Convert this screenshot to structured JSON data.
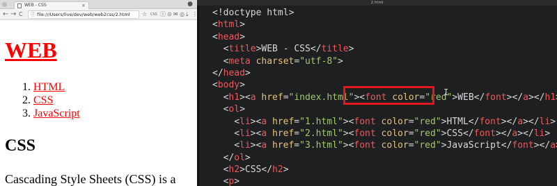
{
  "browser": {
    "tab_title": "WEB - CSS",
    "tab_close": "×",
    "account_icon": "user-circle-icon",
    "nav": {
      "back": "←",
      "forward": "→",
      "reload": "C"
    },
    "address": {
      "info": "ⓘ",
      "url": "file:///Users/live/dev/web/web2css/2.html"
    },
    "toolbar_icons": [
      "☆",
      "CSS",
      "ⓘ",
      "⊙",
      "✉",
      "◎",
      "⤓",
      "⋮"
    ]
  },
  "page": {
    "h1": "WEB",
    "list": [
      {
        "num": "1.",
        "text": "HTML"
      },
      {
        "num": "2.",
        "text": "CSS"
      },
      {
        "num": "3.",
        "text": "JavaScript"
      }
    ],
    "h2": "CSS",
    "paragraph": "Cascading Style Sheets (CSS) is a"
  },
  "editor": {
    "filename": "2.html",
    "cursor_glyph": "I",
    "lines": [
      {
        "indent": 0,
        "tokens": [
          {
            "c": "p",
            "v": "<!doctype html>"
          }
        ]
      },
      {
        "indent": 0,
        "tokens": [
          {
            "c": "p",
            "v": "<"
          },
          {
            "c": "t",
            "v": "html"
          },
          {
            "c": "p",
            "v": ">"
          }
        ]
      },
      {
        "indent": 0,
        "tokens": [
          {
            "c": "p",
            "v": "<"
          },
          {
            "c": "t",
            "v": "head"
          },
          {
            "c": "p",
            "v": ">"
          }
        ]
      },
      {
        "indent": 1,
        "tokens": [
          {
            "c": "p",
            "v": "<"
          },
          {
            "c": "t",
            "v": "title"
          },
          {
            "c": "p",
            "v": ">WEB - CSS</"
          },
          {
            "c": "t",
            "v": "title"
          },
          {
            "c": "p",
            "v": ">"
          }
        ]
      },
      {
        "indent": 1,
        "tokens": [
          {
            "c": "p",
            "v": "<"
          },
          {
            "c": "t",
            "v": "meta"
          },
          {
            "c": "p",
            "v": " "
          },
          {
            "c": "a",
            "v": "charset"
          },
          {
            "c": "p",
            "v": "="
          },
          {
            "c": "s",
            "v": "\"utf-8\""
          },
          {
            "c": "p",
            "v": ">"
          }
        ]
      },
      {
        "indent": 0,
        "tokens": [
          {
            "c": "p",
            "v": "</"
          },
          {
            "c": "t",
            "v": "head"
          },
          {
            "c": "p",
            "v": ">"
          }
        ]
      },
      {
        "indent": 0,
        "tokens": [
          {
            "c": "p",
            "v": "<"
          },
          {
            "c": "t",
            "v": "body"
          },
          {
            "c": "p",
            "v": ">"
          }
        ]
      },
      {
        "indent": 1,
        "tokens": [
          {
            "c": "p",
            "v": "<"
          },
          {
            "c": "t",
            "v": "h1"
          },
          {
            "c": "p",
            "v": "><"
          },
          {
            "c": "t",
            "v": "a"
          },
          {
            "c": "p",
            "v": " "
          },
          {
            "c": "a",
            "v": "href"
          },
          {
            "c": "p",
            "v": "="
          },
          {
            "c": "s",
            "v": "\"index.html\""
          },
          {
            "c": "p",
            "v": "><"
          },
          {
            "c": "t",
            "v": "font"
          },
          {
            "c": "p",
            "v": " "
          },
          {
            "c": "a",
            "v": "color"
          },
          {
            "c": "p",
            "v": "="
          },
          {
            "c": "s",
            "v": "\"red\""
          },
          {
            "c": "p",
            "v": ">WEB</"
          },
          {
            "c": "t",
            "v": "font"
          },
          {
            "c": "p",
            "v": "></"
          },
          {
            "c": "t",
            "v": "a"
          },
          {
            "c": "p",
            "v": "></"
          },
          {
            "c": "t",
            "v": "h1"
          },
          {
            "c": "p",
            "v": ">"
          }
        ]
      },
      {
        "indent": 1,
        "tokens": [
          {
            "c": "p",
            "v": "<"
          },
          {
            "c": "t",
            "v": "ol"
          },
          {
            "c": "p",
            "v": ">"
          }
        ]
      },
      {
        "indent": 2,
        "tokens": [
          {
            "c": "p",
            "v": "<"
          },
          {
            "c": "t",
            "v": "li"
          },
          {
            "c": "p",
            "v": "><"
          },
          {
            "c": "t",
            "v": "a"
          },
          {
            "c": "p",
            "v": " "
          },
          {
            "c": "a",
            "v": "href"
          },
          {
            "c": "p",
            "v": "="
          },
          {
            "c": "s",
            "v": "\"1.html\""
          },
          {
            "c": "p",
            "v": "><"
          },
          {
            "c": "t",
            "v": "font"
          },
          {
            "c": "p",
            "v": " "
          },
          {
            "c": "a",
            "v": "color"
          },
          {
            "c": "p",
            "v": "="
          },
          {
            "c": "s",
            "v": "\"red\""
          },
          {
            "c": "p",
            "v": ">HTML</"
          },
          {
            "c": "t",
            "v": "font"
          },
          {
            "c": "p",
            "v": "></"
          },
          {
            "c": "t",
            "v": "a"
          },
          {
            "c": "p",
            "v": "></"
          },
          {
            "c": "t",
            "v": "li"
          },
          {
            "c": "p",
            "v": ">"
          }
        ]
      },
      {
        "indent": 2,
        "tokens": [
          {
            "c": "p",
            "v": "<"
          },
          {
            "c": "t",
            "v": "li"
          },
          {
            "c": "p",
            "v": "><"
          },
          {
            "c": "t",
            "v": "a"
          },
          {
            "c": "p",
            "v": " "
          },
          {
            "c": "a",
            "v": "href"
          },
          {
            "c": "p",
            "v": "="
          },
          {
            "c": "s",
            "v": "\"2.html\""
          },
          {
            "c": "p",
            "v": "><"
          },
          {
            "c": "t",
            "v": "font"
          },
          {
            "c": "p",
            "v": " "
          },
          {
            "c": "a",
            "v": "color"
          },
          {
            "c": "p",
            "v": "="
          },
          {
            "c": "s",
            "v": "\"red\""
          },
          {
            "c": "p",
            "v": ">CSS</"
          },
          {
            "c": "t",
            "v": "font"
          },
          {
            "c": "p",
            "v": "></"
          },
          {
            "c": "t",
            "v": "a"
          },
          {
            "c": "p",
            "v": "></"
          },
          {
            "c": "t",
            "v": "li"
          },
          {
            "c": "p",
            "v": ">"
          }
        ]
      },
      {
        "indent": 2,
        "tokens": [
          {
            "c": "p",
            "v": "<"
          },
          {
            "c": "t",
            "v": "li"
          },
          {
            "c": "p",
            "v": "><"
          },
          {
            "c": "t",
            "v": "a"
          },
          {
            "c": "p",
            "v": " "
          },
          {
            "c": "a",
            "v": "href"
          },
          {
            "c": "p",
            "v": "="
          },
          {
            "c": "s",
            "v": "\"3.html\""
          },
          {
            "c": "p",
            "v": "><"
          },
          {
            "c": "t",
            "v": "font"
          },
          {
            "c": "p",
            "v": " "
          },
          {
            "c": "a",
            "v": "color"
          },
          {
            "c": "p",
            "v": "="
          },
          {
            "c": "s",
            "v": "\"red\""
          },
          {
            "c": "p",
            "v": ">JavaScript</"
          },
          {
            "c": "t",
            "v": "font"
          },
          {
            "c": "p",
            "v": "></"
          },
          {
            "c": "t",
            "v": "a"
          },
          {
            "c": "p",
            "v": "></"
          },
          {
            "c": "t",
            "v": "li"
          },
          {
            "c": "p",
            "v": ">"
          }
        ]
      },
      {
        "indent": 1,
        "tokens": [
          {
            "c": "p",
            "v": "</"
          },
          {
            "c": "t",
            "v": "ol"
          },
          {
            "c": "p",
            "v": ">"
          }
        ]
      },
      {
        "indent": 1,
        "tokens": [
          {
            "c": "p",
            "v": "<"
          },
          {
            "c": "t",
            "v": "h2"
          },
          {
            "c": "p",
            "v": ">CSS</"
          },
          {
            "c": "t",
            "v": "h2"
          },
          {
            "c": "p",
            "v": ">"
          }
        ]
      },
      {
        "indent": 1,
        "tokens": [
          {
            "c": "p",
            "v": "<"
          },
          {
            "c": "t",
            "v": "p"
          },
          {
            "c": "p",
            "v": ">"
          }
        ]
      }
    ]
  },
  "colors": {
    "tag": "#f0595c",
    "attr": "#e8c07c",
    "string": "#a3c86a",
    "highlight": "#e3161c",
    "link": "#ff0000"
  }
}
